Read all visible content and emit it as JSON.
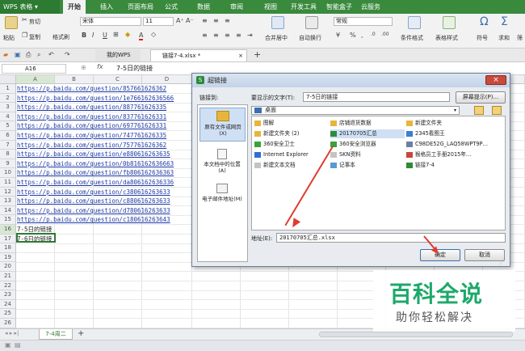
{
  "app": {
    "name": "WPS 表格"
  },
  "menu": [
    "开始",
    "插入",
    "页面布局",
    "公式",
    "数据",
    "审阅",
    "视图",
    "开发工具",
    "智能盒子",
    "云服务"
  ],
  "ribbon": {
    "cut": "剪切",
    "copy": "复制",
    "format_painter": "格式刷",
    "paste": "粘贴",
    "font_name": "宋体",
    "font_size": "11",
    "merge_center": "合并居中",
    "wrap_text": "自动换行",
    "number_format": "常规",
    "percent": "%",
    "thousands": ",",
    "cond_format": "条件格式",
    "table_style": "表格样式",
    "symbol": "符号",
    "sum": "求和",
    "filter": "筛",
    "sort_asc": "A↑",
    "sort_desc": "Z↓"
  },
  "tabs": [
    {
      "label": "我的WPS"
    },
    {
      "label": "链接7-4.xlsx *"
    }
  ],
  "formula_bar": {
    "cell_ref": "A16",
    "fx": "fx",
    "content": "7-5日的链接"
  },
  "columns": [
    "A",
    "B",
    "C",
    "D",
    "E",
    "F",
    "G",
    "H",
    "I",
    "J",
    "K"
  ],
  "rows": [
    {
      "n": "1",
      "text": "https://p.baidu.com/question/857661626362",
      "link": true
    },
    {
      "n": "2",
      "text": "https://p.baidu.com/question/1e766162636566",
      "link": true
    },
    {
      "n": "3",
      "text": "https://p.baidu.com/question/887761626335",
      "link": true
    },
    {
      "n": "4",
      "text": "https://p.baidu.com/question/837761626331",
      "link": true
    },
    {
      "n": "5",
      "text": "https://p.baidu.com/question/697761626331",
      "link": true
    },
    {
      "n": "6",
      "text": "https://p.baidu.com/question/747761626335",
      "link": true
    },
    {
      "n": "7",
      "text": "https://p.baidu.com/question/757761626362",
      "link": true
    },
    {
      "n": "8",
      "text": "https://p.baidu.com/question/e880616263635",
      "link": true
    },
    {
      "n": "9",
      "text": "https://p.baidu.com/question/0b816162636663",
      "link": true
    },
    {
      "n": "10",
      "text": "https://p.baidu.com/question/fb806162636363",
      "link": true
    },
    {
      "n": "11",
      "text": "https://p.baidu.com/question/da806162636336",
      "link": true
    },
    {
      "n": "12",
      "text": "https://p.baidu.com/question/c380616263633",
      "link": true
    },
    {
      "n": "13",
      "text": "https://p.baidu.com/question/c880616263633",
      "link": true
    },
    {
      "n": "14",
      "text": "https://p.baidu.com/question/d780616263633",
      "link": true
    },
    {
      "n": "15",
      "text": "https://p.baidu.com/question/c180616263643",
      "link": true
    },
    {
      "n": "16",
      "text": "7-5日的链接",
      "link": false
    },
    {
      "n": "17",
      "text": "7-6日的链接",
      "link": false
    },
    {
      "n": "18",
      "text": "",
      "link": false
    },
    {
      "n": "19",
      "text": "",
      "link": false
    },
    {
      "n": "20",
      "text": "",
      "link": false
    },
    {
      "n": "21",
      "text": "",
      "link": false
    },
    {
      "n": "22",
      "text": "",
      "link": false
    },
    {
      "n": "23",
      "text": "",
      "link": false
    },
    {
      "n": "24",
      "text": "",
      "link": false
    },
    {
      "n": "25",
      "text": "",
      "link": false
    },
    {
      "n": "26",
      "text": "",
      "link": false
    }
  ],
  "sheet_tab": "7-4周二",
  "dialog": {
    "title": "超链接",
    "link_to_label": "链接到:",
    "display_text_label": "要显示的文字(T):",
    "display_text_value": "7-5日的链接",
    "screen_tip": "屏幕提示(P)...",
    "look_in_label": "查找范围:",
    "look_in_value": "桌面",
    "sidebar": [
      "原有文件或网页(X)",
      "本文档中的位置(A)",
      "电子邮件地址(M)"
    ],
    "files": [
      {
        "name": "图解",
        "icon": "folder-icon",
        "color": "#e7b53b"
      },
      {
        "name": "店铺退货数据",
        "icon": "folder-icon",
        "color": "#e7b53b"
      },
      {
        "name": "新建文件夹",
        "icon": "folder-icon",
        "color": "#e7b53b"
      },
      {
        "name": "新建文件夹 (2)",
        "icon": "folder-icon",
        "color": "#e7b53b"
      },
      {
        "name": "20170705汇总",
        "icon": "excel-file-icon",
        "color": "#2f8a3a"
      },
      {
        "name": "2345看图王",
        "icon": "app-icon",
        "color": "#3a7fd0"
      },
      {
        "name": "360安全卫士",
        "icon": "shield-icon",
        "color": "#3aa23a"
      },
      {
        "name": "360安全浏览器",
        "icon": "browser-icon",
        "color": "#3aa23a"
      },
      {
        "name": "C98DE52G_LAQ58WPT9P…",
        "icon": "image-file-icon",
        "color": "#6a7fa5"
      },
      {
        "name": "Internet Explorer",
        "icon": "ie-icon",
        "color": "#2f6fd0"
      },
      {
        "name": "SKN资料",
        "icon": "doc-file-icon",
        "color": "#c4c4c4"
      },
      {
        "name": "猴格员工手册2015年…",
        "icon": "pdf-file-icon",
        "color": "#c8473a"
      },
      {
        "name": "新建文本文档",
        "icon": "text-file-icon",
        "color": "#c4c4c4"
      },
      {
        "name": "记事本",
        "icon": "notepad-icon",
        "color": "#5a9ad0"
      },
      {
        "name": "链接7-4",
        "icon": "excel-file-icon",
        "color": "#2f8a3a"
      }
    ],
    "address_label": "地址(E):",
    "address_value": "20170705汇总.xlsx",
    "ok": "确定",
    "cancel": "取消"
  },
  "watermark": {
    "title": "百科全说",
    "subtitle": "助你轻松解决"
  }
}
